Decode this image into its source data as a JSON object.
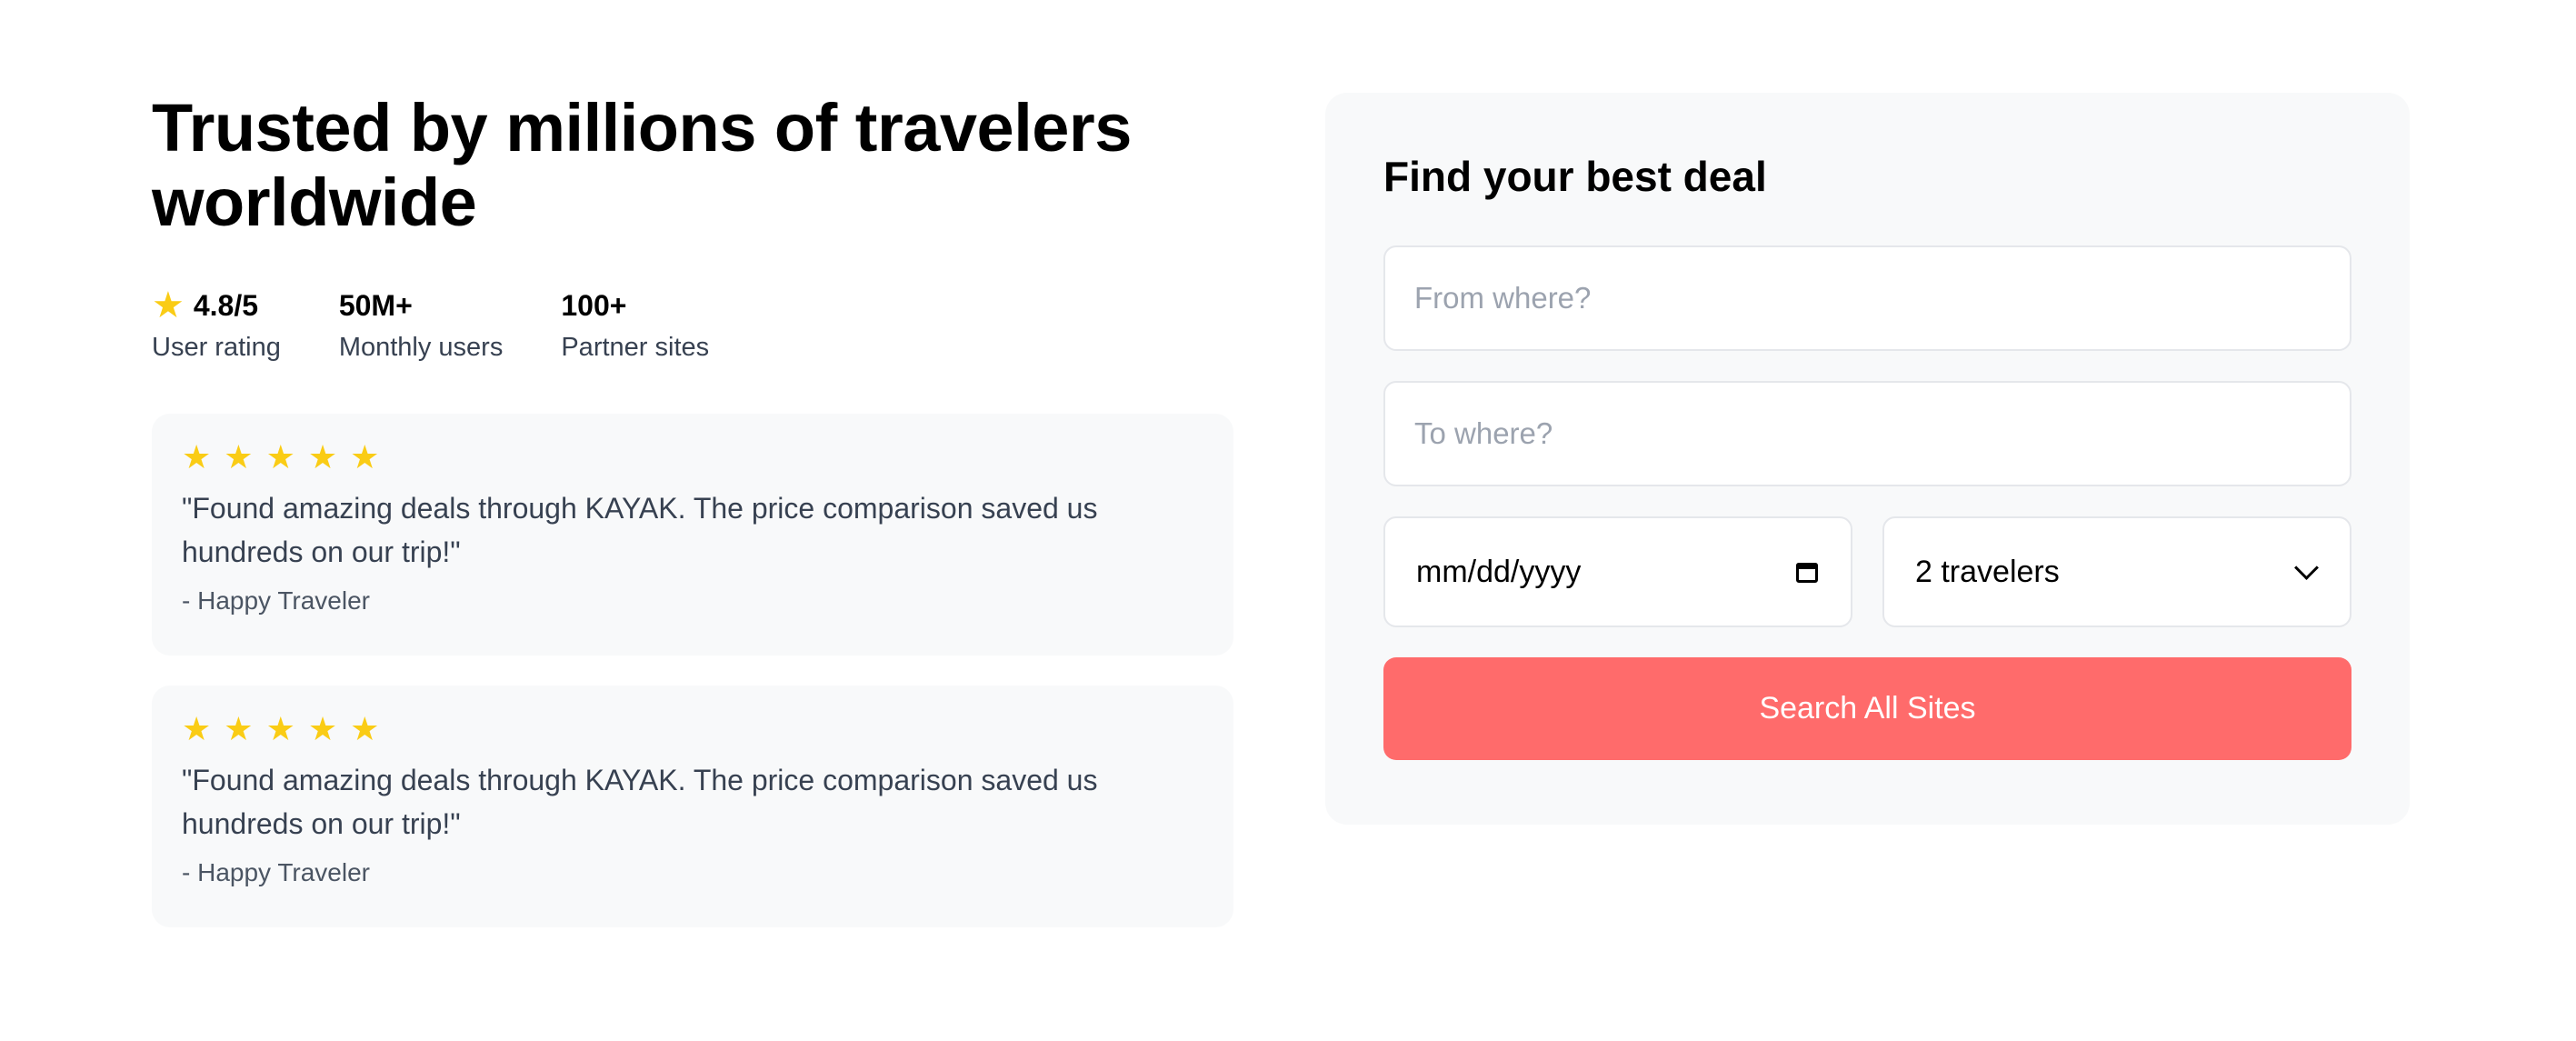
{
  "hero": {
    "title": "Trusted by millions of travelers worldwide"
  },
  "stats": [
    {
      "value": "4.8/5",
      "label": "User rating",
      "icon": "star-icon"
    },
    {
      "value": "50M+",
      "label": "Monthly users"
    },
    {
      "value": "100+",
      "label": "Partner sites"
    }
  ],
  "reviews": [
    {
      "rating": 5,
      "quote": "\"Found amazing deals through KAYAK. The price comparison saved us hundreds on our trip!\"",
      "author": "- Happy Traveler"
    },
    {
      "rating": 5,
      "quote": "\"Found amazing deals through KAYAK. The price comparison saved us hundreds on our trip!\"",
      "author": "- Happy Traveler"
    }
  ],
  "search": {
    "title": "Find your best deal",
    "from_placeholder": "From where?",
    "to_placeholder": "To where?",
    "date_placeholder": "mm/dd/yyyy",
    "travelers_selected": "2 travelers",
    "button_label": "Search All Sites"
  },
  "colors": {
    "accent": "#ff6b6b",
    "star": "#facc15",
    "card_bg": "#f8f9fa"
  }
}
